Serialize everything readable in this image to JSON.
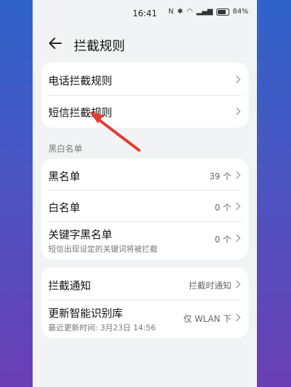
{
  "status": {
    "time": "16:41",
    "battery": "84%"
  },
  "header": {
    "title": "拦截规则"
  },
  "rules_card": {
    "items": [
      {
        "label": "电话拦截规则"
      },
      {
        "label": "短信拦截规则"
      }
    ]
  },
  "blacklist_section": {
    "title": "黑白名单",
    "items": [
      {
        "label": "黑名单",
        "value": "39 个"
      },
      {
        "label": "白名单",
        "value": "0 个"
      },
      {
        "label": "关键字黑名单",
        "value": "0 个",
        "sub": "短信出现设定的关键词将被拦截"
      }
    ]
  },
  "notify_card": {
    "items": [
      {
        "label": "拦截通知",
        "value": "拦截时通知"
      },
      {
        "label": "更新智能识别库",
        "value": "仅 WLAN 下",
        "sub": "最近更新时间: 3月23日 14:56"
      }
    ]
  },
  "colors": {
    "annotation_arrow": "#e53935"
  }
}
